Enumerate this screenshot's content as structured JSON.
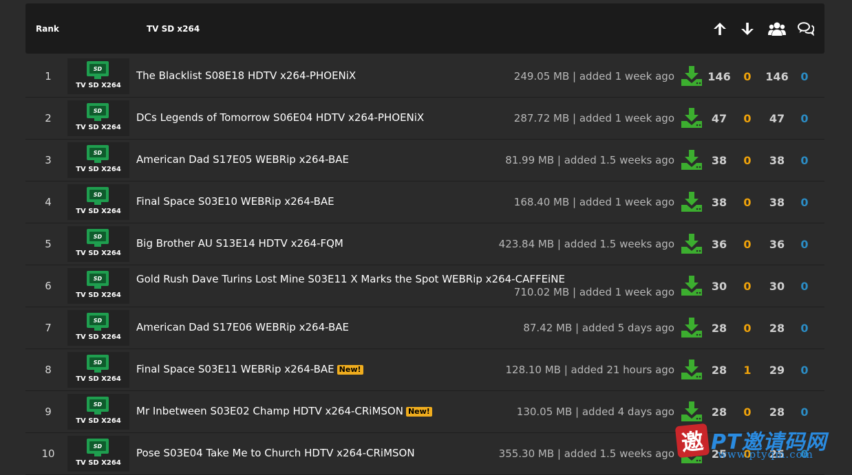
{
  "header": {
    "rank_label": "Rank",
    "category_label": "TV SD x264",
    "icons": [
      "arrow-up-icon",
      "arrow-down-icon",
      "users-icon",
      "comments-icon"
    ]
  },
  "colors": {
    "accent_green": "#1f9e4f",
    "leech_orange": "#f0a30a",
    "comment_blue": "#2b8cc4",
    "new_badge": "#f0ad1e"
  },
  "badge": {
    "screen_text": "SD",
    "label": "TV SD X264"
  },
  "new_label": "New!",
  "rows": [
    {
      "rank": "1",
      "title": "The Blacklist S08E18 HDTV x264-PHOENiX",
      "info": "249.05 MB | added 1 week ago",
      "seeders": "146",
      "leechers": "0",
      "completed": "146",
      "comments": "0",
      "new": false,
      "wrap": false
    },
    {
      "rank": "2",
      "title": "DCs Legends of Tomorrow S06E04 HDTV x264-PHOENiX",
      "info": "287.72 MB | added 1 week ago",
      "seeders": "47",
      "leechers": "0",
      "completed": "47",
      "comments": "0",
      "new": false,
      "wrap": false
    },
    {
      "rank": "3",
      "title": "American Dad S17E05 WEBRip x264-BAE",
      "info": "81.99 MB | added 1.5 weeks ago",
      "seeders": "38",
      "leechers": "0",
      "completed": "38",
      "comments": "0",
      "new": false,
      "wrap": false
    },
    {
      "rank": "4",
      "title": "Final Space S03E10 WEBRip x264-BAE",
      "info": "168.40 MB | added 1 week ago",
      "seeders": "38",
      "leechers": "0",
      "completed": "38",
      "comments": "0",
      "new": false,
      "wrap": false
    },
    {
      "rank": "5",
      "title": "Big Brother AU S13E14 HDTV x264-FQM",
      "info": "423.84 MB | added 1.5 weeks ago",
      "seeders": "36",
      "leechers": "0",
      "completed": "36",
      "comments": "0",
      "new": false,
      "wrap": false
    },
    {
      "rank": "6",
      "title": "Gold Rush Dave Turins Lost Mine S03E11 X Marks the Spot WEBRip x264-CAFFEiNE",
      "info": "710.02 MB | added 1 week ago",
      "seeders": "30",
      "leechers": "0",
      "completed": "30",
      "comments": "0",
      "new": false,
      "wrap": true
    },
    {
      "rank": "7",
      "title": "American Dad S17E06 WEBRip x264-BAE",
      "info": "87.42 MB | added 5 days ago",
      "seeders": "28",
      "leechers": "0",
      "completed": "28",
      "comments": "0",
      "new": false,
      "wrap": false
    },
    {
      "rank": "8",
      "title": "Final Space S03E11 WEBRip x264-BAE",
      "info": "128.10 MB | added 21 hours ago",
      "seeders": "28",
      "leechers": "1",
      "completed": "29",
      "comments": "0",
      "new": true,
      "wrap": false
    },
    {
      "rank": "9",
      "title": "Mr Inbetween S03E02 Champ HDTV x264-CRiMSON",
      "info": "130.05 MB | added 4 days ago",
      "seeders": "28",
      "leechers": "0",
      "completed": "28",
      "comments": "0",
      "new": true,
      "wrap": false
    },
    {
      "rank": "10",
      "title": "Pose S03E04 Take Me to Church HDTV x264-CRiMSON",
      "info": "355.30 MB | added 1.5 weeks ago",
      "seeders": "25",
      "leechers": "0",
      "completed": "25",
      "comments": "0",
      "new": false,
      "wrap": false
    }
  ],
  "watermark": {
    "seal": "邀",
    "name": "PT邀请码网",
    "url": "www.ptyqm.com"
  }
}
